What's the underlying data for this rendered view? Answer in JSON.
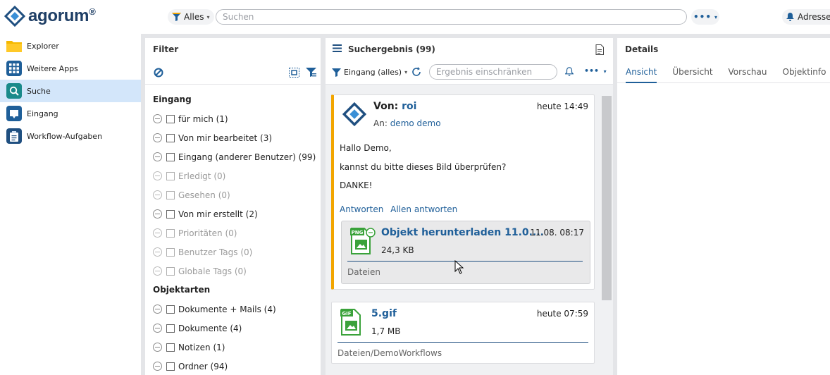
{
  "brand": {
    "name": "agorum",
    "reg": "®"
  },
  "top": {
    "scope_label": "Alles",
    "search_placeholder": "Suchen",
    "user_label": "Adressen"
  },
  "nav": [
    {
      "label": "Explorer",
      "icon": "folder-icon",
      "color": "#f5b800"
    },
    {
      "label": "Weitere Apps",
      "icon": "apps-grid-icon",
      "color": "#1f5f99"
    },
    {
      "label": "Suche",
      "icon": "search-icon",
      "color": "#1a8a8a"
    },
    {
      "label": "Eingang",
      "icon": "inbox-icon",
      "color": "#1f5f99"
    },
    {
      "label": "Workflow-Aufgaben",
      "icon": "clipboard-icon",
      "color": "#1f4f80"
    }
  ],
  "filter": {
    "title": "Filter",
    "sections": [
      {
        "title": "Eingang",
        "items": [
          {
            "label": "für mich (1)",
            "dim": false
          },
          {
            "label": "Von mir bearbeitet (3)",
            "dim": false
          },
          {
            "label": "Eingang (anderer Benutzer) (99)",
            "dim": false
          },
          {
            "label": "Erledigt (0)",
            "dim": true
          },
          {
            "label": "Gesehen (0)",
            "dim": true
          },
          {
            "label": "Von mir erstellt (2)",
            "dim": false
          },
          {
            "label": "Prioritäten (0)",
            "dim": true
          },
          {
            "label": "Benutzer Tags (0)",
            "dim": true
          },
          {
            "label": "Globale Tags (0)",
            "dim": true
          }
        ]
      },
      {
        "title": "Objektarten",
        "items": [
          {
            "label": "Dokumente + Mails (4)",
            "dim": false
          },
          {
            "label": "Dokumente (4)",
            "dim": false
          },
          {
            "label": "Notizen (1)",
            "dim": false
          },
          {
            "label": "Ordner (94)",
            "dim": false
          }
        ]
      }
    ]
  },
  "results": {
    "title": "Suchergebnis (99)",
    "inbox_filter": "Eingang (alles)",
    "refine_placeholder": "Ergebnis einschränken",
    "card1": {
      "from_prefix": "Von:",
      "from": "roi",
      "time": "heute 14:49",
      "to_prefix": "An:",
      "to": "demo demo",
      "lines": [
        "Hallo Demo,",
        "kannst du bitte dieses Bild überprüfen?",
        "DANKE!"
      ],
      "reply": "Antworten",
      "reply_all": "Allen antworten",
      "attachment": {
        "name": "Objekt herunterladen 11.0....",
        "date": "11.08. 08:17",
        "size": "24,3 KB",
        "path": "Dateien",
        "type_badge": "PNG"
      }
    },
    "card2": {
      "name": "5.gif",
      "time": "heute 07:59",
      "size": "1,7 MB",
      "path_a": "Dateien",
      "path_b": "/DemoWorkflows",
      "type_badge": "GIF"
    }
  },
  "details": {
    "title": "Details",
    "tabs": [
      "Ansicht",
      "Übersicht",
      "Vorschau",
      "Objektinfo"
    ]
  },
  "colors": {
    "accent": "#1f5f99",
    "highlight": "#f2a500",
    "active_nav": "#d3e6fa",
    "file_green": "#3aa23a"
  }
}
